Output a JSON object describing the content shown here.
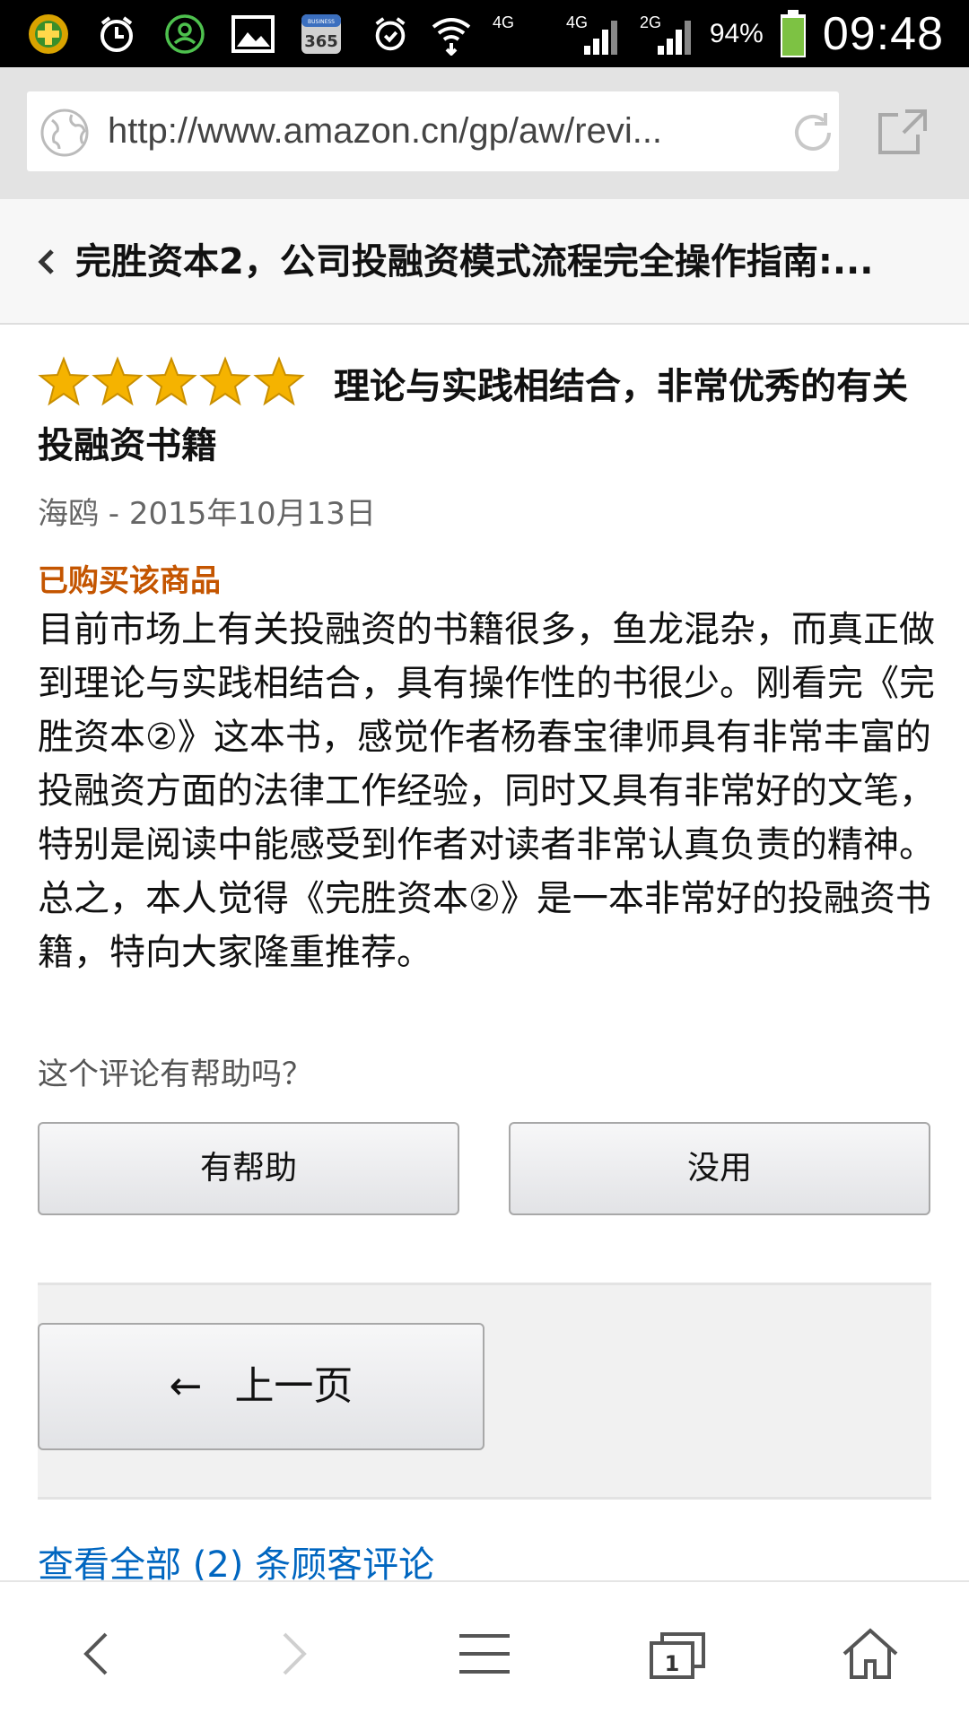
{
  "status_bar": {
    "icons_left": [
      "game-app-icon",
      "alarm-icon",
      "contacts-icon",
      "gallery-icon",
      "calendar-365-icon"
    ],
    "calendar_label": "365",
    "calendar_sub": "BUSINESS",
    "icons_right": [
      "alarm-clock-icon",
      "wifi-icon",
      "signal-4g-icon",
      "signal-4g-icon",
      "signal-2g-icon"
    ],
    "net1": "4G",
    "net2": "4G",
    "net3": "2G",
    "battery": "94%",
    "time": "09:48"
  },
  "browser": {
    "url": "http://www.amazon.cn/gp/aw/revi...",
    "icons": [
      "globe-icon",
      "reload-icon",
      "share-icon"
    ]
  },
  "header": {
    "title": "完胜资本2，公司投融资模式流程完全操作指南:..."
  },
  "review": {
    "rating": 5,
    "rating_max": 5,
    "title": "理论与实践相结合，非常优秀的有关投融资书籍",
    "meta": "海鸥 - 2015年10月13日",
    "verified": "已购买该商品",
    "body": "目前市场上有关投融资的书籍很多，鱼龙混杂，而真正做到理论与实践相结合，具有操作性的书很少。刚看完《完胜资本②》这本书，感觉作者杨春宝律师具有非常丰富的投融资方面的法律工作经验，同时又具有非常好的文笔，特别是阅读中能感受到作者对读者非常认真负责的精神。总之，本人觉得《完胜资本②》是一本非常好的投融资书籍，特向大家隆重推荐。",
    "helpful_question": "这个评论有帮助吗？",
    "helpful_yes": "有帮助",
    "helpful_no": "没用"
  },
  "pager": {
    "prev_arrow": "←",
    "prev_label": "上一页"
  },
  "links": {
    "all_reviews": "查看全部 (2) 条顾客评论"
  },
  "bottom_nav": {
    "tabs_count": "1",
    "icons": [
      "back-icon",
      "forward-icon",
      "menu-icon",
      "tabs-icon",
      "home-icon"
    ]
  },
  "colors": {
    "star": "#f5b300",
    "verified": "#c45500",
    "link": "#0066c0",
    "battery": "#7dc243"
  }
}
